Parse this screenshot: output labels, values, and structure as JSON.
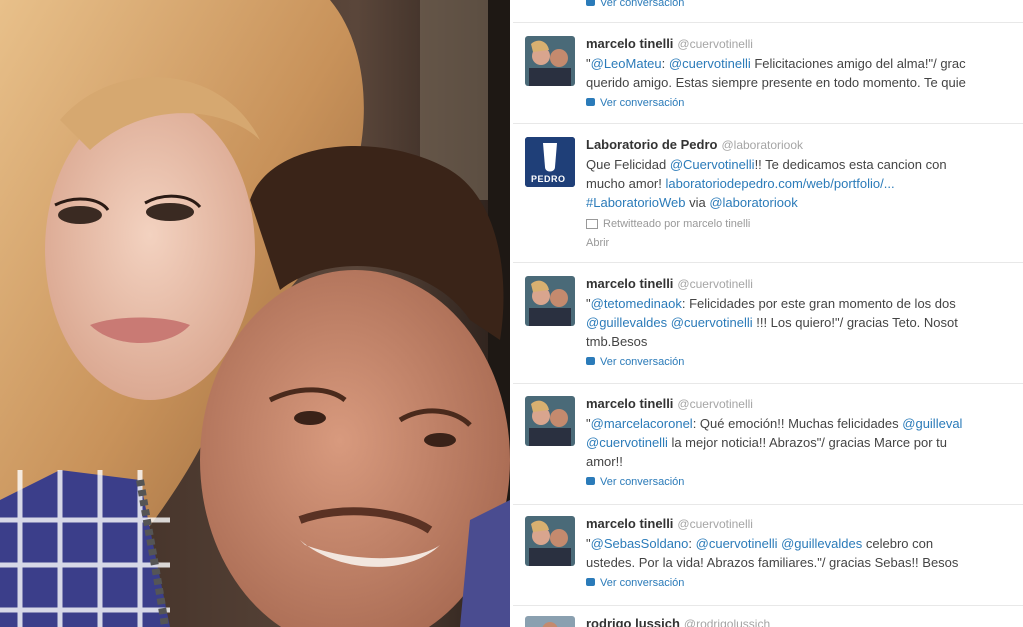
{
  "photo": {
    "description_label": ""
  },
  "tweets": [
    {
      "footer": "Ver conversación"
    },
    {
      "name": "marcelo tinelli",
      "handle": "@cuervotinelli",
      "line1_parts": [
        {
          "t": "\"",
          "m": false
        },
        {
          "t": "@LeoMateu",
          "m": true
        },
        {
          "t": ": ",
          "m": false
        },
        {
          "t": "@cuervotinelli",
          "m": true
        },
        {
          "t": " Felicitaciones amigo del alma!\"/ grac",
          "m": false
        }
      ],
      "line2": "querido amigo. Estas siempre presente en todo momento. Te quie",
      "footer": "Ver conversación"
    },
    {
      "name": "Laboratorio de Pedro",
      "handle": "@laboratoriook",
      "line1_parts": [
        {
          "t": "Que Felicidad ",
          "m": false
        },
        {
          "t": "@Cuervotinelli",
          "m": true
        },
        {
          "t": "!! Te dedicamos esta cancion con",
          "m": false
        }
      ],
      "line2_parts": [
        {
          "t": "mucho amor! ",
          "m": false
        },
        {
          "t": "laboratoriodepedro.com/web/portfolio/...",
          "m": true
        }
      ],
      "line3_parts": [
        {
          "t": "#LaboratorioWeb",
          "m": true
        },
        {
          "t": " via ",
          "m": false
        },
        {
          "t": "@laboratoriook",
          "m": true
        }
      ],
      "retweet": "Retwitteado por marcelo tinelli",
      "open": "Abrir",
      "avatar_text": "PEDRO"
    },
    {
      "name": "marcelo tinelli",
      "handle": "@cuervotinelli",
      "line1_parts": [
        {
          "t": "\"",
          "m": false
        },
        {
          "t": "@tetomedinaok",
          "m": true
        },
        {
          "t": ": Felicidades por este gran momento de los dos",
          "m": false
        }
      ],
      "line2_parts": [
        {
          "t": "@guillevaldes",
          "m": true
        },
        {
          "t": " ",
          "m": false
        },
        {
          "t": "@cuervotinelli",
          "m": true
        },
        {
          "t": " !!! Los quiero!\"/ gracias Teto. Nosot",
          "m": false
        }
      ],
      "line3": "tmb.Besos",
      "footer": "Ver conversación"
    },
    {
      "name": "marcelo tinelli",
      "handle": "@cuervotinelli",
      "line1_parts": [
        {
          "t": "\"",
          "m": false
        },
        {
          "t": "@marcelacoronel",
          "m": true
        },
        {
          "t": ": Qué emoción!! Muchas felicidades ",
          "m": false
        },
        {
          "t": "@guilleval",
          "m": true
        }
      ],
      "line2_parts": [
        {
          "t": "@cuervotinelli",
          "m": true
        },
        {
          "t": " la mejor noticia!! Abrazos\"/ gracias Marce por tu",
          "m": false
        }
      ],
      "line3": "amor!!",
      "footer": "Ver conversación"
    },
    {
      "name": "marcelo tinelli",
      "handle": "@cuervotinelli",
      "line1_parts": [
        {
          "t": "\"",
          "m": false
        },
        {
          "t": "@SebasSoldano",
          "m": true
        },
        {
          "t": ": ",
          "m": false
        },
        {
          "t": "@cuervotinelli",
          "m": true
        },
        {
          "t": " ",
          "m": false
        },
        {
          "t": "@guillevaldes",
          "m": true
        },
        {
          "t": " celebro con",
          "m": false
        }
      ],
      "line2": "ustedes. Por la vida! Abrazos familiares.\"/ gracias Sebas!! Besos",
      "footer": "Ver conversación"
    },
    {
      "name": "rodrigo lussich",
      "handle": "@rodrigolussich"
    }
  ],
  "colors": {
    "mention": "#2b7bb9",
    "name": "#333333",
    "handle": "#a5a5a5",
    "text": "#444444"
  }
}
